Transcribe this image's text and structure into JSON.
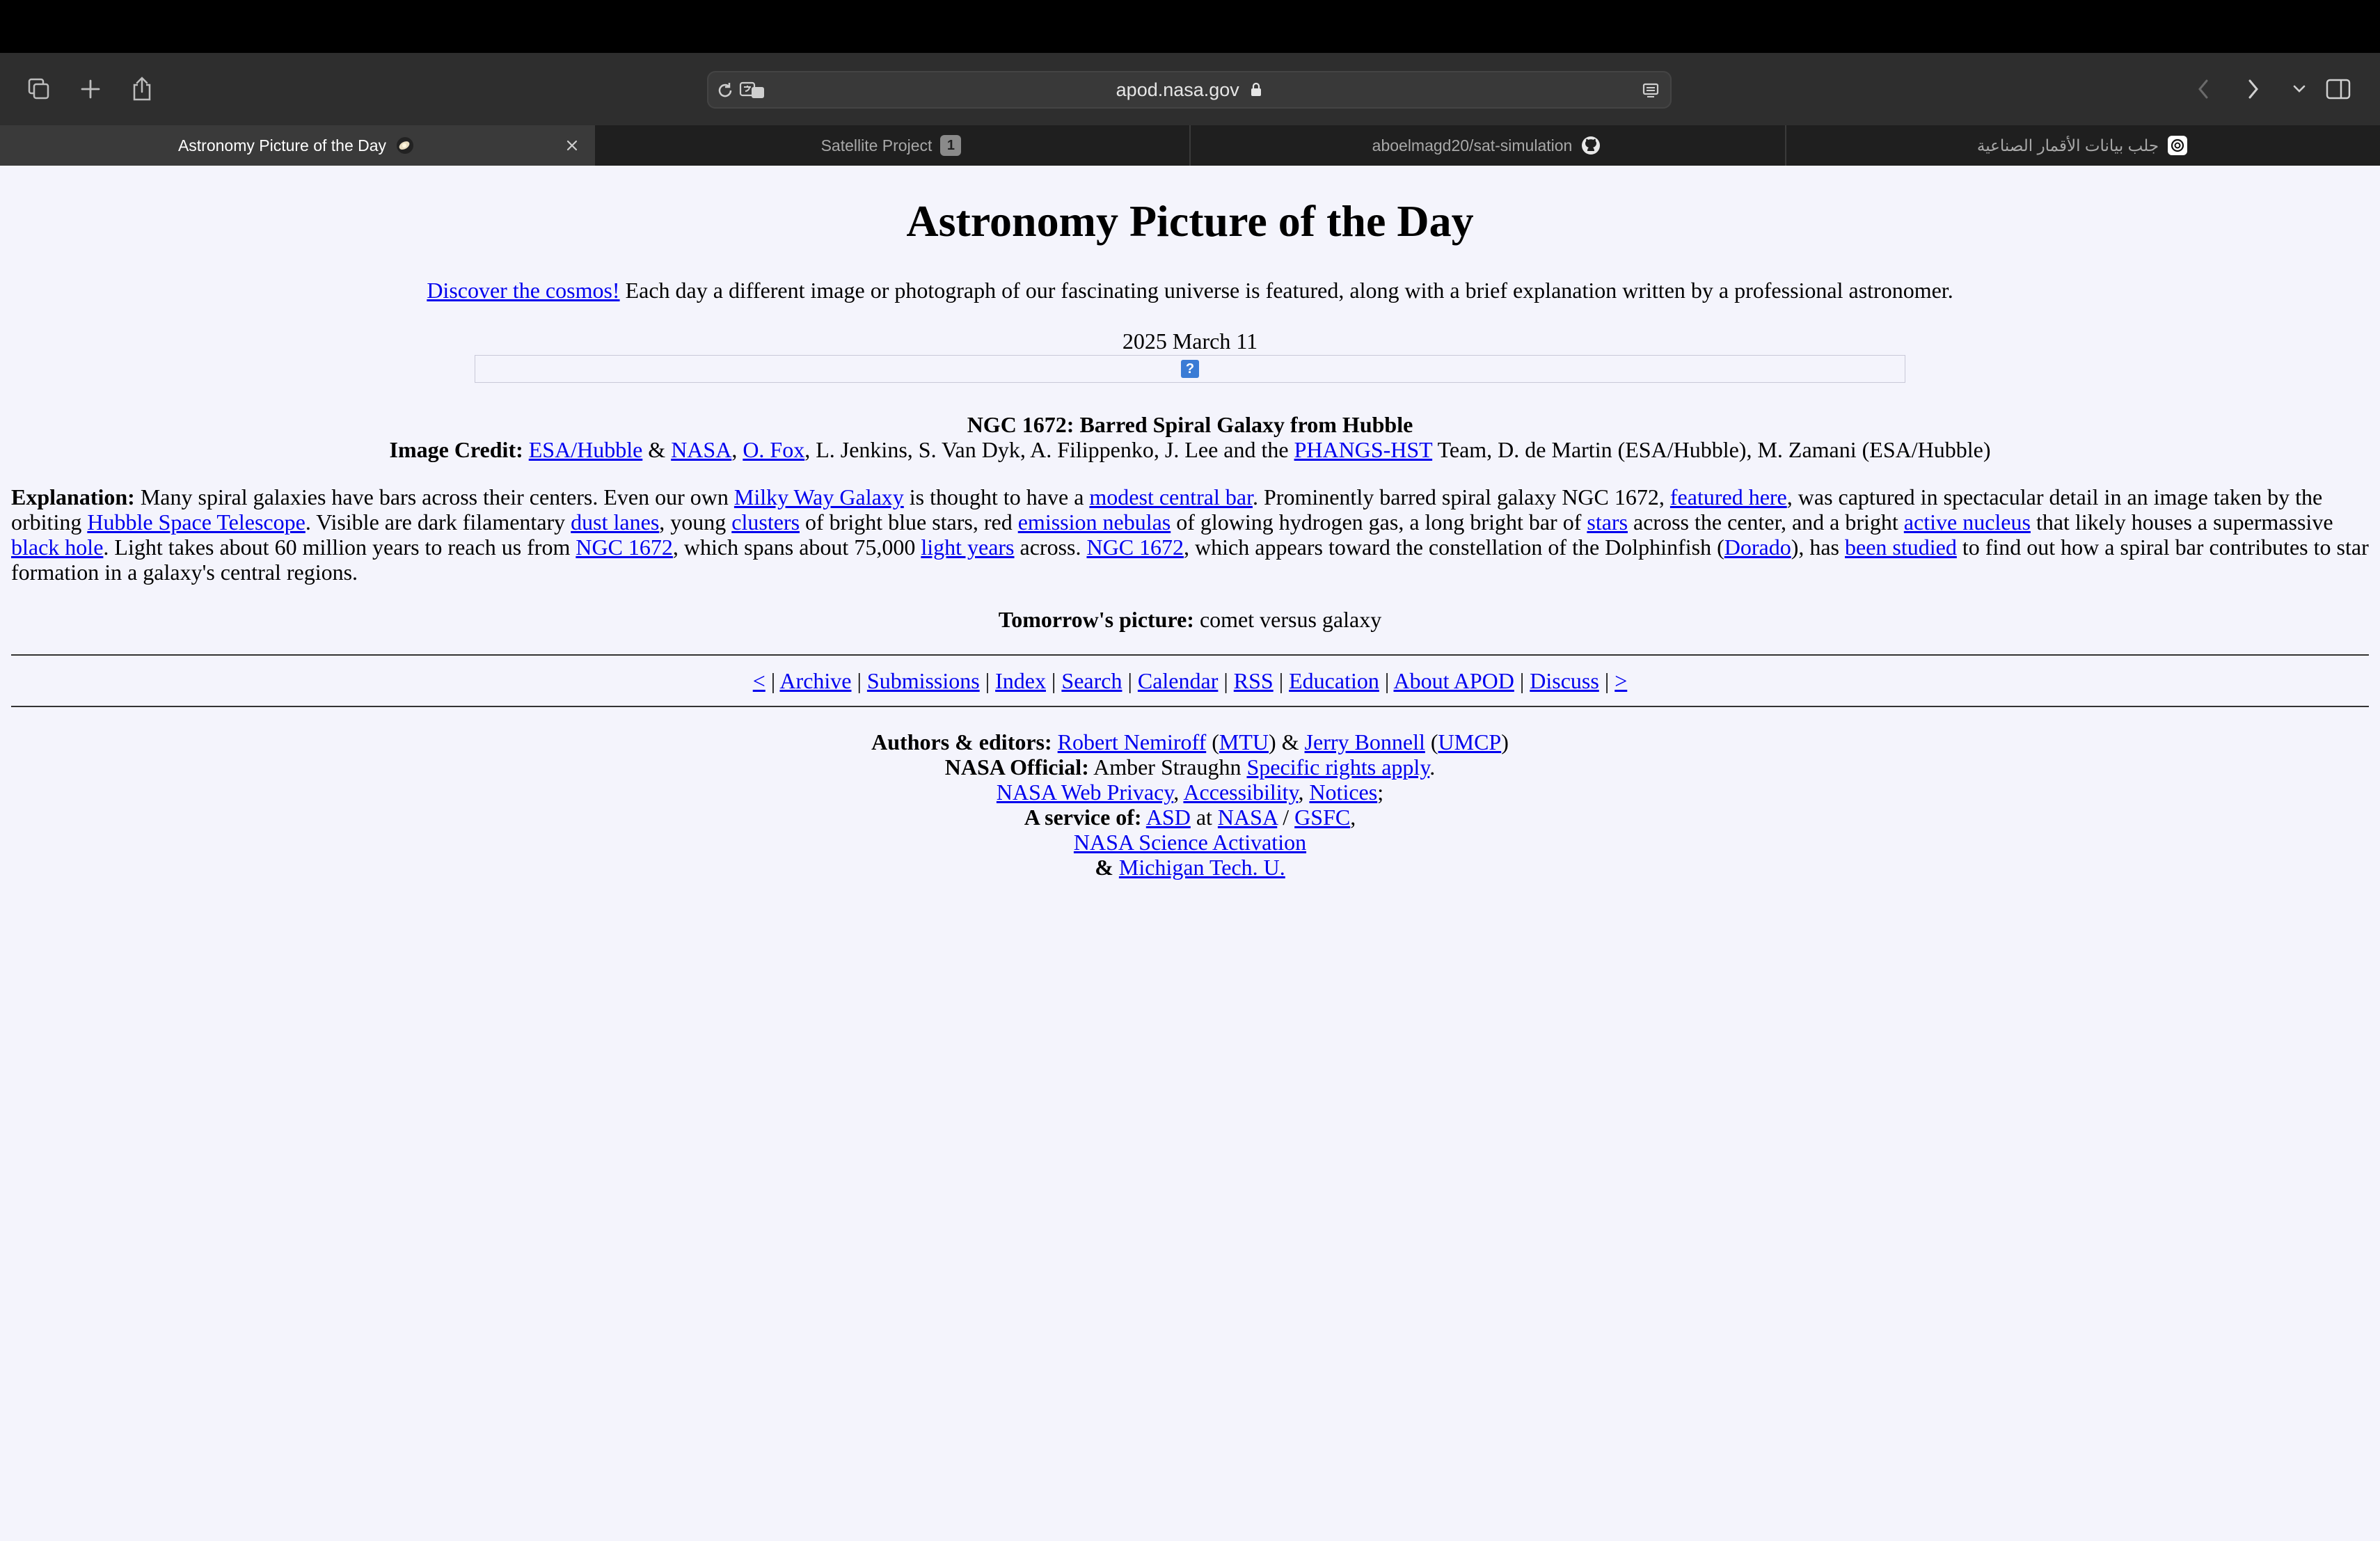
{
  "browser": {
    "url": "apod.nasa.gov",
    "tabs": [
      {
        "label": "Astronomy Picture of the Day",
        "active": true
      },
      {
        "label": "Satellite Project",
        "badge": "1"
      },
      {
        "label": "aboelmagd20/sat-simulation"
      },
      {
        "label": "جلب بيانات الأقمار الصناعية"
      }
    ]
  },
  "page": {
    "heading": "Astronomy Picture of the Day",
    "intro_link": "Discover the cosmos!",
    "intro_text": " Each day a different image or photograph of our fascinating universe is featured, along with a brief explanation written by a professional astronomer.",
    "date": "2025 March 11",
    "image_placeholder": "?",
    "title": "NGC 1672: Barred Spiral Galaxy from Hubble",
    "credit": {
      "label": "Image Credit:",
      "l1": "ESA/Hubble",
      "t1": " & ",
      "l2": "NASA",
      "t2": ", ",
      "l3": "O. Fox",
      "t3": ", L. Jenkins, S. Van Dyk, A. Filippenko, J. Lee and the ",
      "l4": "PHANGS-HST",
      "t4": " Team, D. de Martin (ESA/Hubble), M. Zamani (ESA/Hubble)"
    },
    "explanation": {
      "label": "Explanation:",
      "t0": " Many spiral galaxies have bars across their centers. Even our own ",
      "l1": "Milky Way Galaxy",
      "t1": " is thought to have a ",
      "l2": "modest central bar",
      "t2": ". Prominently barred spiral galaxy NGC 1672, ",
      "l3": "featured here",
      "t3": ", was captured in spectacular detail in an image taken by the orbiting ",
      "l4": "Hubble Space Telescope",
      "t4": ". Visible are dark filamentary ",
      "l5": "dust lanes",
      "t5": ", young ",
      "l6": "clusters",
      "t6": " of bright blue stars, red ",
      "l7": "emission nebulas",
      "t7": " of glowing hydrogen gas, a long bright bar of ",
      "l8": "stars",
      "t8": " across the center, and a bright ",
      "l9": "active nucleus",
      "t9": " that likely houses a supermassive ",
      "l10": "black hole",
      "t10": ". Light takes about 60 million years to reach us from ",
      "l11": "NGC 1672",
      "t11": ", which spans about 75,000 ",
      "l12": "light years",
      "t12": " across. ",
      "l13": "NGC 1672",
      "t13": ", which appears toward the constellation of the Dolphinfish (",
      "l14": "Dorado",
      "t14": "), has ",
      "l15": "been studied",
      "t15": " to find out how a spiral bar contributes to star formation in a galaxy's central regions."
    },
    "tomorrow": {
      "label": "Tomorrow's picture:",
      "text": " comet versus galaxy"
    },
    "nav": {
      "prev": "<",
      "archive": "Archive",
      "submissions": "Submissions",
      "index": "Index",
      "search": "Search",
      "calendar": "Calendar",
      "rss": "RSS",
      "education": "Education",
      "about": "About APOD",
      "discuss": "Discuss",
      "next": ">",
      "sep": " | "
    },
    "footer": {
      "authors_label": "Authors & editors:",
      "nemiroff": "Robert Nemiroff",
      "mtu": "MTU",
      "bonnell": "Jerry Bonnell",
      "umcp": "UMCP",
      "official_label": "NASA Official:",
      "official_name": " Amber Straughn ",
      "rights": "Specific rights apply",
      "privacy": "NASA Web Privacy",
      "accessibility": "Accessibility",
      "notices": "Notices",
      "service_label": "A service of:",
      "asd": "ASD",
      "at": " at ",
      "nasa": "NASA",
      "slash": " / ",
      "gsfc": "GSFC",
      "science": "NASA Science Activation",
      "amp": "& ",
      "michigan": "Michigan Tech. U."
    }
  }
}
